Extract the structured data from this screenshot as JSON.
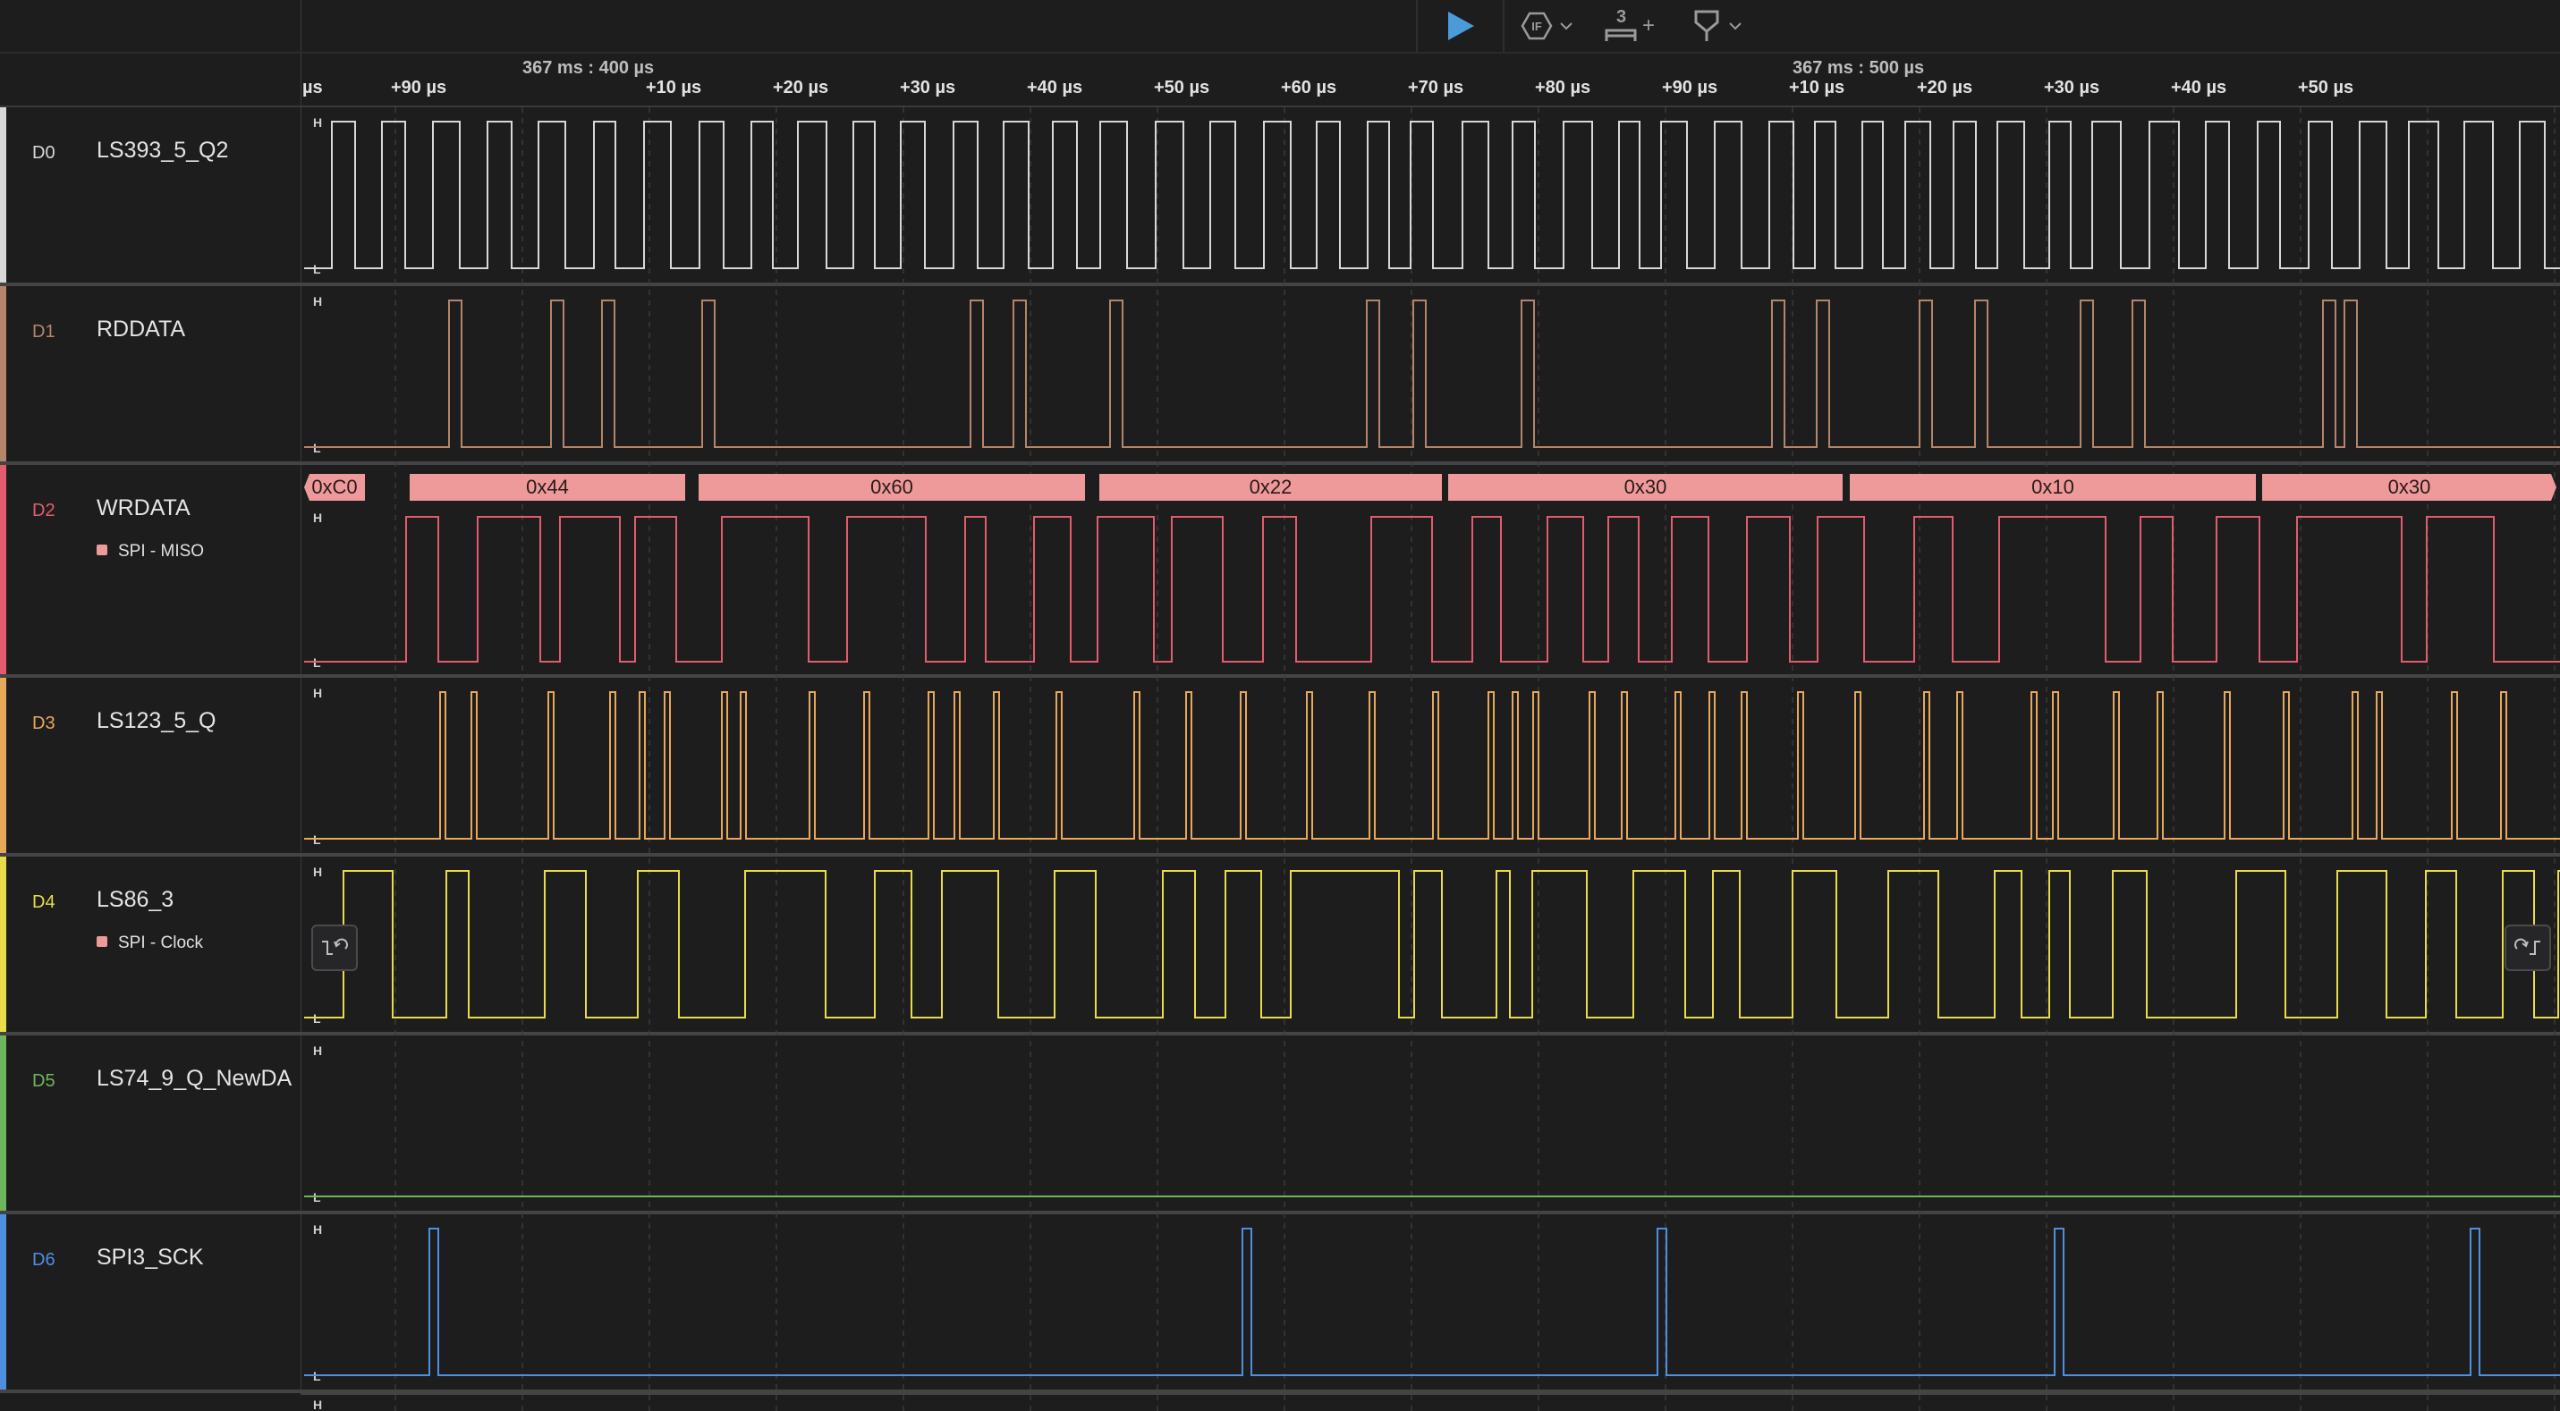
{
  "toolbar": {
    "play_icon": "play-icon",
    "trigger_icon": "trigger-icon",
    "measure_icon": "measure-icon",
    "measure_count": "3",
    "measure_plus": "+",
    "marker_icon": "marker-icon"
  },
  "ruler": {
    "ticks": [
      "µs",
      "+90 µs",
      "+10 µs",
      "+20 µs",
      "+30 µs",
      "+40 µs",
      "+50 µs",
      "+60 µs",
      "+70 µs",
      "+80 µs",
      "+90 µs",
      "+10 µs",
      "+20 µs",
      "+30 µs",
      "+40 µs",
      "+50 µs"
    ],
    "major": [
      "367 ms : 400 µs",
      "367 ms : 500 µs"
    ]
  },
  "channels": [
    {
      "id": "D0",
      "name": "LS393_5_Q2",
      "color": "#d8d8d8",
      "analyzer": ""
    },
    {
      "id": "D1",
      "name": "RDDATA",
      "color": "#b5856a",
      "analyzer": ""
    },
    {
      "id": "D2",
      "name": "WRDATA",
      "color": "#e25c6e",
      "analyzer": "SPI - MISO"
    },
    {
      "id": "D3",
      "name": "LS123_5_Q",
      "color": "#e8a85a",
      "analyzer": ""
    },
    {
      "id": "D4",
      "name": "LS86_3",
      "color": "#e8dc4a",
      "analyzer": "SPI - Clock"
    },
    {
      "id": "D5",
      "name": "LS74_9_Q_NewDA",
      "color": "#6fb55b",
      "analyzer": ""
    },
    {
      "id": "D6",
      "name": "SPI3_SCK",
      "color": "#4f8fe0",
      "analyzer": ""
    }
  ],
  "level_labels": {
    "high": "H",
    "low": "L"
  },
  "spi_bytes": [
    "0xC0",
    "0x44",
    "0x60",
    "0x22",
    "0x30",
    "0x10",
    "0x30"
  ],
  "colors": {
    "background": "#1d1d1e",
    "accent": "#4a9bd9",
    "protocol_box": "#ef9a9a"
  }
}
